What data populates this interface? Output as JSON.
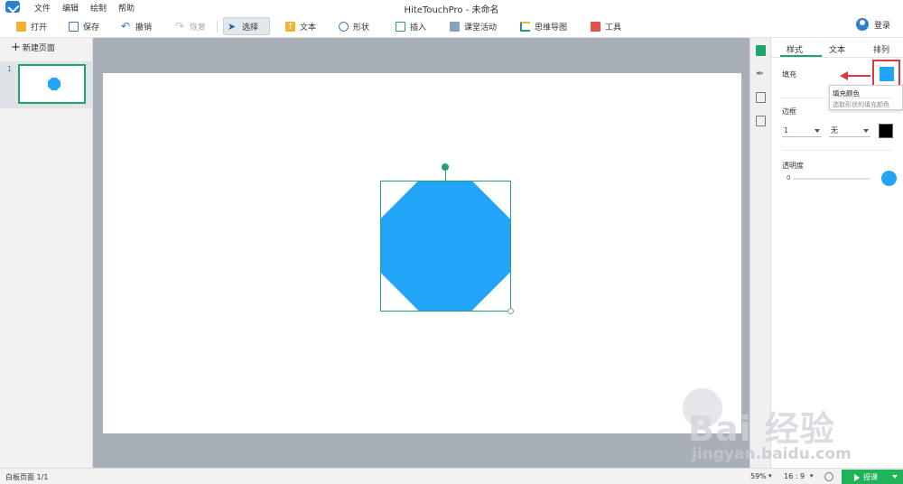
{
  "menu": [
    "文件",
    "编辑",
    "绘制",
    "帮助"
  ],
  "window_title": "HiteTouchPro - 未命名",
  "toolbar": {
    "open": "打开",
    "save": "保存",
    "undo": "撤销",
    "redo": "恢复",
    "select": "选择",
    "text": "文本",
    "shape": "形状",
    "insert": "插入",
    "class_activity": "课堂活动",
    "mind_map": "思维导图",
    "tools": "工具",
    "login": "登录"
  },
  "left_panel": {
    "new_page": "新建页面",
    "page_number": "1"
  },
  "right_panel": {
    "tabs": [
      "样式",
      "文本",
      "排列"
    ],
    "fill_label": "填充",
    "tooltip_title": "填充颜色",
    "tooltip_desc": "选取形状的填充颜色",
    "border_label": "边框",
    "border_width": "1",
    "border_style": "无",
    "opacity_label": "透明度",
    "opacity_value": "0"
  },
  "status": {
    "page_info": "白板页面 1/1",
    "zoom": "59%",
    "ratio": "16 : 9",
    "play": "授课"
  },
  "watermark": {
    "logo": "Bai 经验",
    "url": "jingyan.baidu.com"
  },
  "colors": {
    "accent": "#1fa46b",
    "shape_fill": "#22a4f8",
    "annotation_red": "#e0373a",
    "canvas_bg": "#a9afb9"
  }
}
